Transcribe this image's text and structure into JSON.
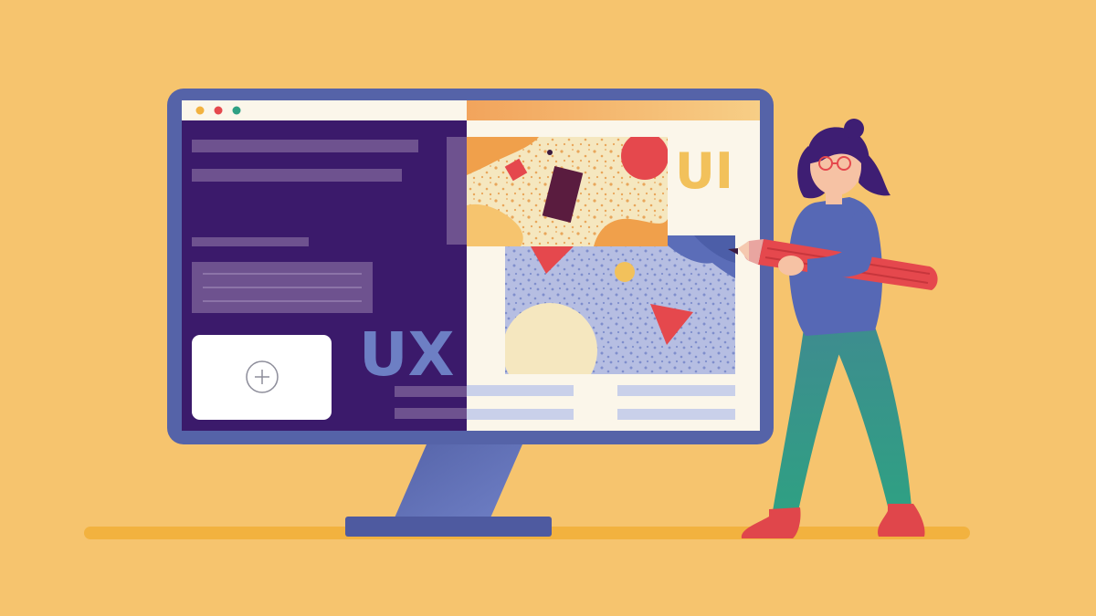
{
  "illustration": {
    "ux_label": "UX",
    "ui_label": "UI"
  },
  "colors": {
    "background": "#F6C46E",
    "floor": "#F2B23F",
    "monitor_frame": "#5563A8",
    "ux_panel": "#3B1A6B",
    "ui_panel": "#FBF6EA",
    "accent_red": "#E5484D",
    "accent_orange": "#F0A04B",
    "accent_blue": "#6D7FC4",
    "hair": "#3E1E73",
    "sweater": "#5668B5",
    "pants": "#2F9A86"
  },
  "icons": {
    "window_dots": "traffic-light-dots",
    "add_card": "plus-circle-icon"
  }
}
